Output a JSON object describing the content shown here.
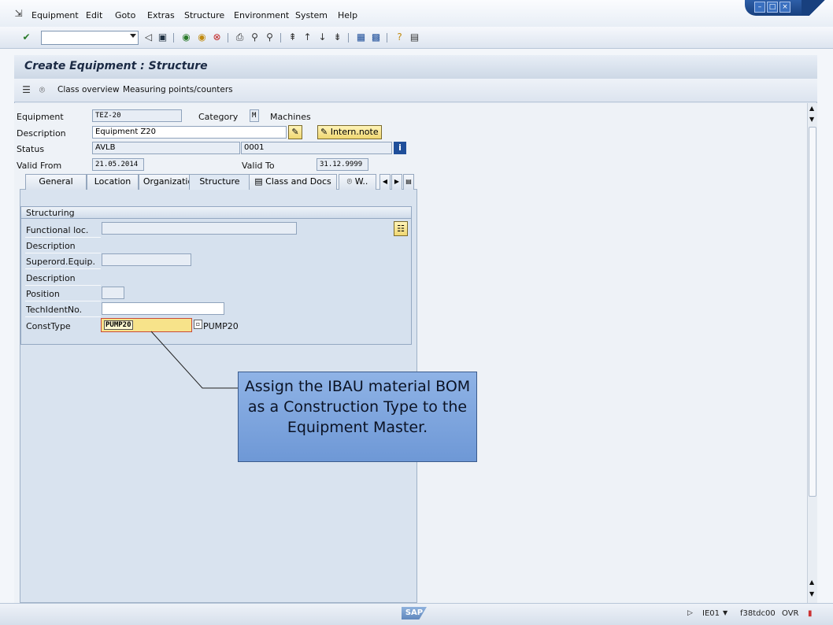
{
  "menu": {
    "items": [
      "Equipment",
      "Edit",
      "Goto",
      "Extras",
      "Structure",
      "Environment",
      "System",
      "Help"
    ]
  },
  "toolbar": {
    "command_value": ""
  },
  "page": {
    "title": "Create Equipment : Structure"
  },
  "app_toolbar": {
    "class_overview": "Class overview",
    "measuring_points": "Measuring points/counters"
  },
  "header": {
    "equipment_label": "Equipment",
    "equipment_value": "TEZ-20",
    "category_label": "Category",
    "category_value": "M",
    "category_text": "Machines",
    "description_label": "Description",
    "description_value": "Equipment Z20",
    "intern_note": "Intern.note",
    "status_label": "Status",
    "status_value": "AVLB",
    "status_value2": "0001",
    "valid_from_label": "Valid From",
    "valid_from_value": "21.05.2014",
    "valid_to_label": "Valid To",
    "valid_to_value": "31.12.9999"
  },
  "tabs": [
    "General",
    "Location",
    "Organization",
    "Structure",
    "Class and Docs",
    "W.."
  ],
  "structuring": {
    "title": "Structuring",
    "functional_loc_label": "Functional loc.",
    "functional_loc_value": "",
    "description1_label": "Description",
    "superord_label": "Superord.Equip.",
    "superord_value": "",
    "description2_label": "Description",
    "position_label": "Position",
    "position_value": "",
    "techident_label": "TechIdentNo.",
    "techident_value": "",
    "consttype_label": "ConstType",
    "consttype_value": "PUMP20",
    "consttype_text": "PUMP20"
  },
  "callout": {
    "text": "Assign the IBAU material BOM as a Construction Type to the Equipment Master."
  },
  "statusbar": {
    "logo": "SAP",
    "transaction": "IE01",
    "server": "f38tdc00",
    "mode": "OVR"
  },
  "colors": {
    "callout_fill": "#7ea5de",
    "highlight_field": "#f7e38a",
    "title_text": "#1b2a44"
  }
}
